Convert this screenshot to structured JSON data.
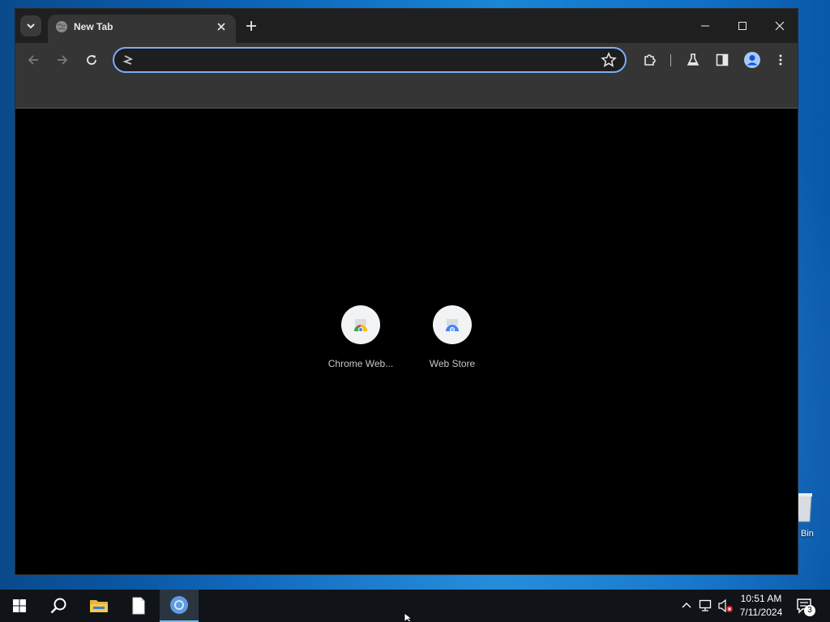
{
  "desktop": {
    "recycle_bin_label": "Bin"
  },
  "browser": {
    "tab": {
      "title": "New Tab"
    },
    "omnibox": {
      "value": "",
      "placeholder": ""
    },
    "shortcuts": [
      {
        "label": "Chrome Web..."
      },
      {
        "label": "Web Store"
      }
    ]
  },
  "taskbar": {
    "clock": {
      "time": "10:51 AM",
      "date": "7/11/2024"
    },
    "notification_count": "3"
  },
  "colors": {
    "omnibox_focus": "#7cacf8",
    "toolbar_bg": "#353535",
    "page_bg": "#000000",
    "taskbar_bg": "#101418"
  }
}
